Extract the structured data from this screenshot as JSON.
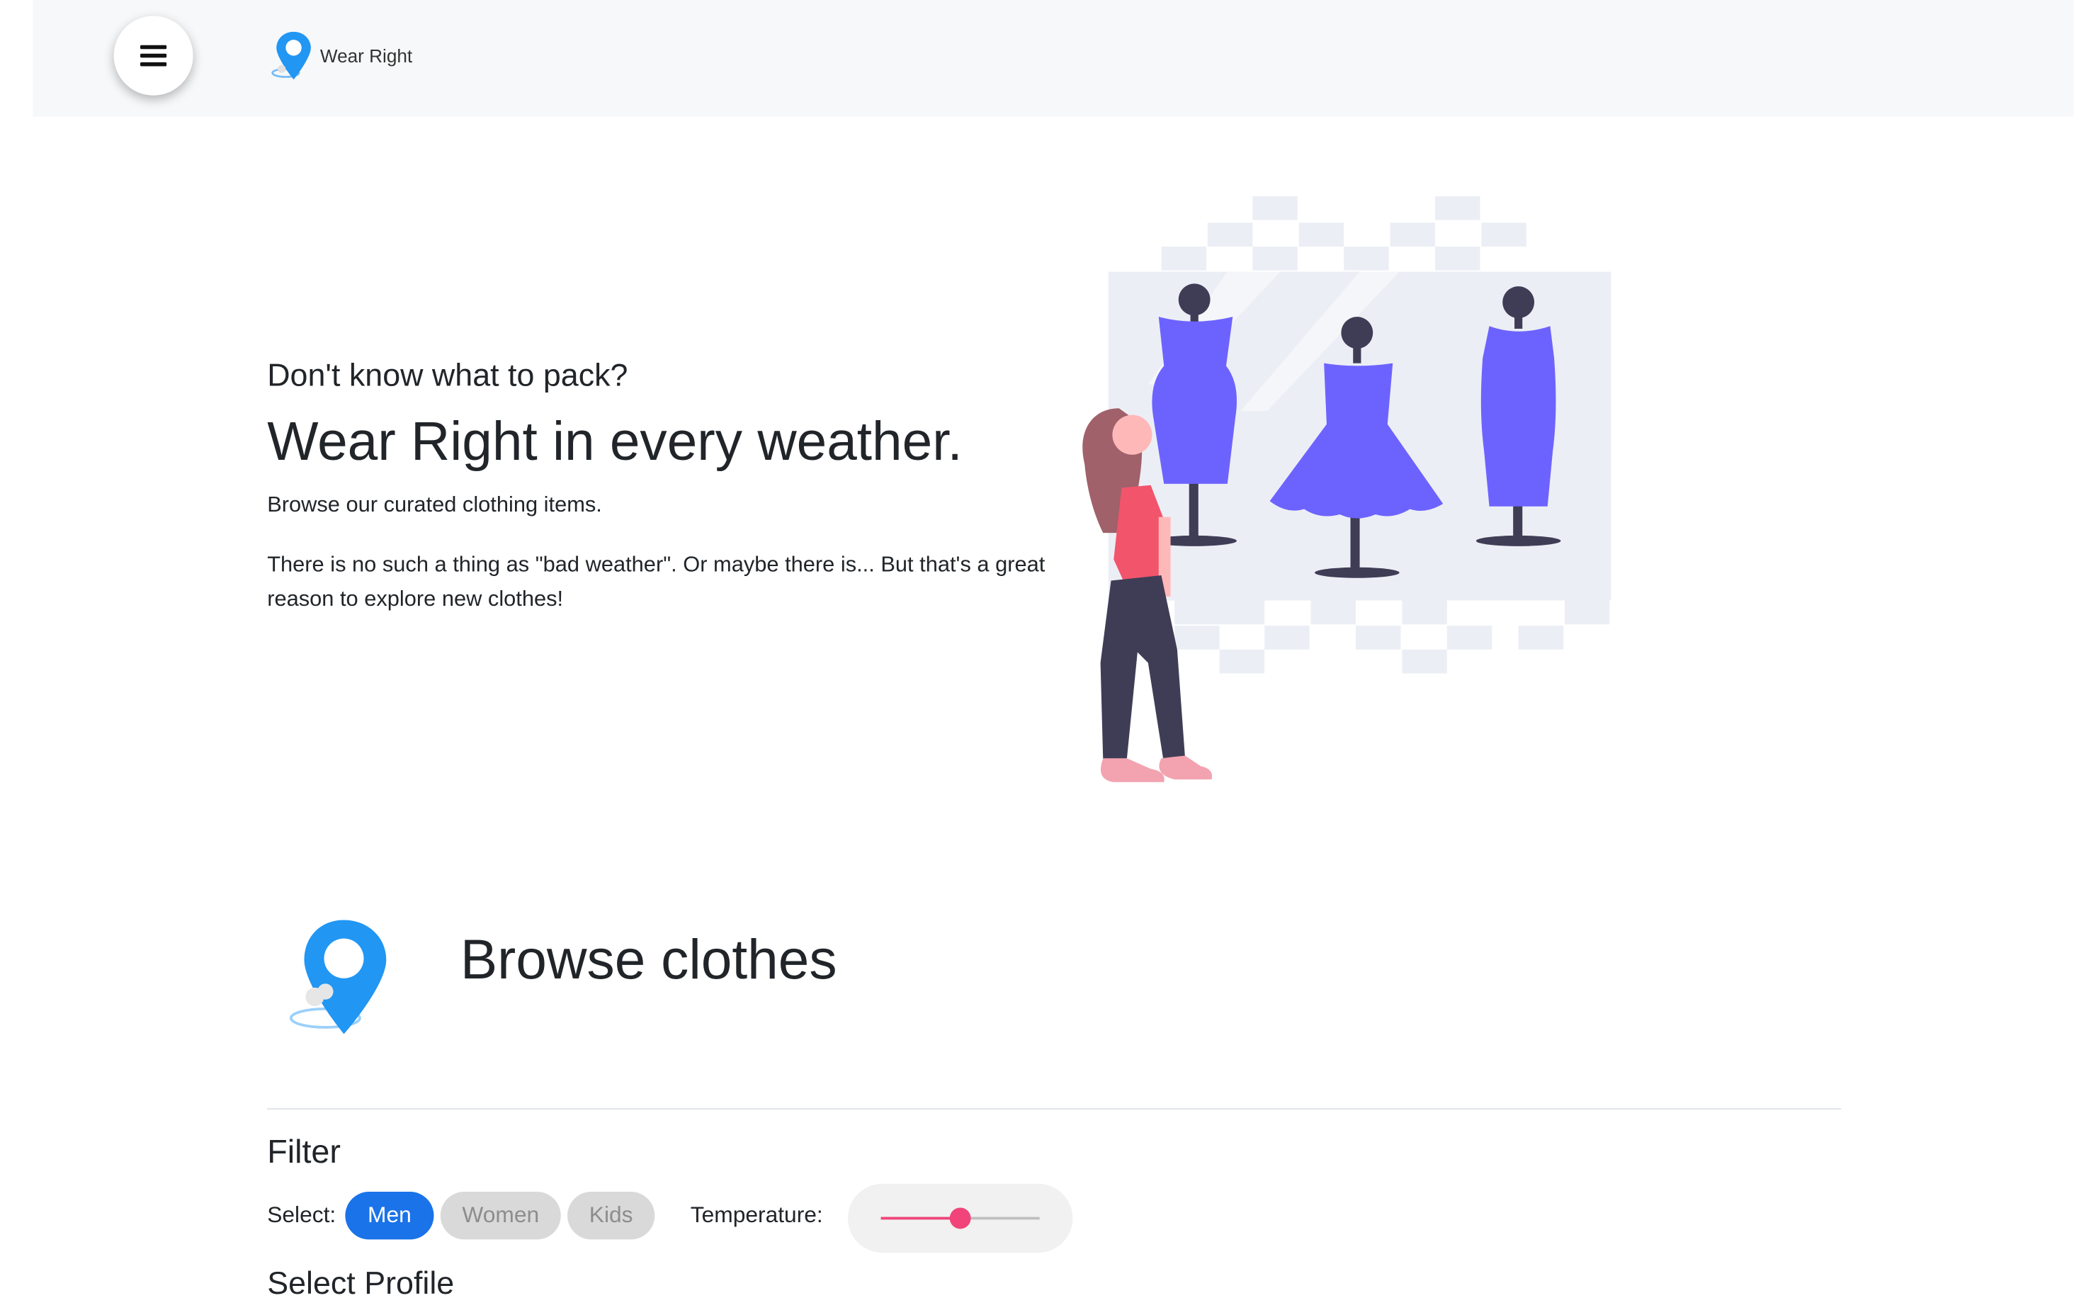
{
  "header": {
    "menu_icon": "hamburger-icon",
    "brand_icon": "location-pin-icon",
    "brand_name": "Wear Right"
  },
  "hero": {
    "subtitle": "Don't know what to pack?",
    "title": "Wear Right in every weather.",
    "lead": "Browse our curated clothing items.",
    "text": "There is no such a thing as \"bad weather\". Or maybe there is... But that's a great reason to explore new clothes!",
    "illustration": "woman-looking-at-dresses-illustration"
  },
  "browse": {
    "icon": "location-pin-icon",
    "title": "Browse clothes"
  },
  "filter": {
    "title": "Filter",
    "select_label": "Select:",
    "options": [
      {
        "label": "Men",
        "selected": true
      },
      {
        "label": "Women",
        "selected": false
      },
      {
        "label": "Kids",
        "selected": false
      }
    ],
    "temperature_label": "Temperature:",
    "temperature_level": 0.5
  },
  "profile": {
    "title": "Select Profile"
  },
  "colors": {
    "accent": "#1a73e8",
    "slider": "#f0447a",
    "brand_pin": "#2196f3",
    "illustration_dress": "#6c63ff"
  }
}
